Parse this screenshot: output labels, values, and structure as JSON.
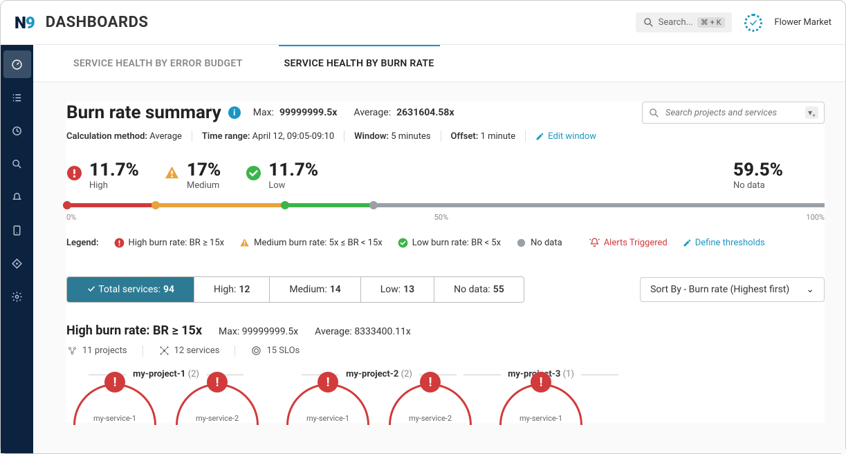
{
  "header": {
    "app": "DASHBOARDS",
    "search_placeholder": "Search...",
    "kbd": "⌘ + K",
    "org": "Flower Market"
  },
  "tabs": {
    "t1": "SERVICE HEALTH BY ERROR BUDGET",
    "t2": "SERVICE HEALTH BY BURN RATE"
  },
  "title": "Burn rate summary",
  "topstats": {
    "max_label": "Max:",
    "max": "99999999.5x",
    "avg_label": "Average:",
    "avg": "2631604.58x"
  },
  "meta": {
    "calc_label": "Calculation method:",
    "calc": "Average",
    "time_label": "Time range:",
    "time": "April 12, 09:05-09:10",
    "win_label": "Window:",
    "win": "5 minutes",
    "off_label": "Offset:",
    "off": "1 minute",
    "edit": "Edit window"
  },
  "search2": {
    "placeholder": "Search projects and services"
  },
  "cats": {
    "high": {
      "pct": "11.7%",
      "lbl": "High"
    },
    "med": {
      "pct": "17%",
      "lbl": "Medium"
    },
    "low": {
      "pct": "11.7%",
      "lbl": "Low"
    },
    "nodata": {
      "pct": "59.5%",
      "lbl": "No data"
    }
  },
  "ticks": {
    "t0": "0%",
    "t50": "50%",
    "t100": "100%"
  },
  "legend": {
    "title": "Legend:",
    "high": "High burn rate: BR ≥ 15x",
    "med": "Medium burn rate: 5x ≤ BR < 15x",
    "low": "Low burn rate: BR < 5x",
    "nodata": "No data",
    "alerts": "Alerts Triggered",
    "define": "Define thresholds"
  },
  "filters": {
    "total": {
      "label": "Total services:",
      "n": "94"
    },
    "high": {
      "label": "High:",
      "n": "12"
    },
    "med": {
      "label": "Medium:",
      "n": "14"
    },
    "low": {
      "label": "Low:",
      "n": "13"
    },
    "nodata": {
      "label": "No data:",
      "n": "55"
    }
  },
  "sort": "Sort By - Burn rate (Highest first)",
  "section": {
    "title": "High burn rate: BR ≥ 15x",
    "max_l": "Max:",
    "max": "99999999.5x",
    "avg_l": "Average:",
    "avg": "8333400.11x",
    "projects": "11 projects",
    "services": "12 services",
    "slos": "15 SLOs"
  },
  "projects": [
    {
      "name": "my-project-1",
      "count": "(2)",
      "services": [
        "my-service-1",
        "my-service-2"
      ]
    },
    {
      "name": "my-project-2",
      "count": "(2)",
      "services": [
        "my-service-1",
        "my-service-2"
      ]
    },
    {
      "name": "my-project-3",
      "count": "(1)",
      "services": [
        "my-service-1"
      ]
    }
  ]
}
